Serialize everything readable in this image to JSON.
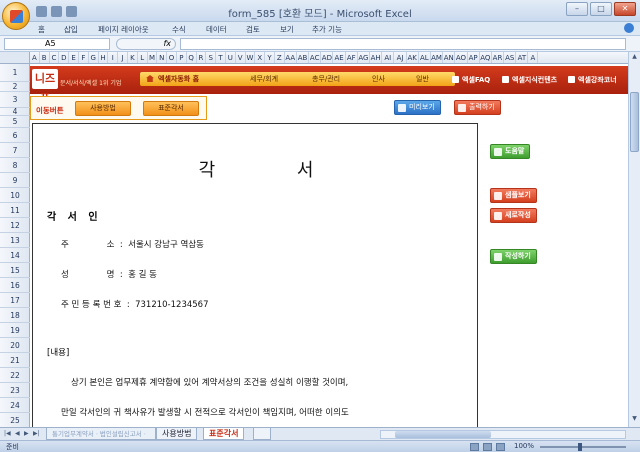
{
  "window": {
    "title": "form_585  [호환 모드] - Microsoft Excel"
  },
  "menu_tabs": [
    "홈",
    "삽입",
    "페이지 레이아웃",
    "수식",
    "데이터",
    "검토",
    "보기",
    "추가 기능"
  ],
  "formula_bar": {
    "cell_ref": "A5",
    "fx_label": "fx",
    "value": ""
  },
  "columns": [
    "A",
    "B",
    "C",
    "D",
    "E",
    "F",
    "G",
    "H",
    "I",
    "J",
    "K",
    "L",
    "M",
    "N",
    "O",
    "P",
    "Q",
    "R",
    "S",
    "T",
    "U",
    "V",
    "W",
    "X",
    "Y",
    "Z",
    "AA",
    "AB",
    "AC",
    "AD",
    "AE",
    "AF",
    "AG",
    "AH",
    "AI",
    "AJ",
    "AK",
    "AL",
    "AM",
    "AN",
    "AO",
    "AP",
    "AQ",
    "AR",
    "AS",
    "AT",
    "A"
  ],
  "rows": [
    "1",
    "2",
    "3",
    "4",
    "5",
    "6",
    "7",
    "8",
    "9",
    "10",
    "11",
    "12",
    "13",
    "14",
    "15",
    "16",
    "17",
    "18",
    "19",
    "20",
    "21",
    "22",
    "23",
    "24",
    "25"
  ],
  "banner": {
    "logo": "니즈폼",
    "logo_sub": "문서/서식/엑셀 1위 기업",
    "home": "엑셀자동화 홈",
    "nav": [
      "세무/회계",
      "총무/관리",
      "인사",
      "일반"
    ],
    "links": [
      "엑셀FAQ",
      "엑셀지식컨텐츠",
      "엑셀강좌코너"
    ]
  },
  "shortcuts": {
    "label": "이동버튼",
    "buttons": [
      "사용방법",
      "표준각서"
    ]
  },
  "actions": {
    "preview": "미리보기",
    "print": "출력하기"
  },
  "side_buttons": {
    "help": "도움말",
    "sample": "샘플보기",
    "new": "새로작성",
    "write": "작성하기"
  },
  "document": {
    "title": "각 서",
    "subtitle": "각 서 인",
    "fields": [
      {
        "label": "주              소",
        "value": "서울시 강남구 역삼동"
      },
      {
        "label": "성              명",
        "value": "홍 길 동"
      },
      {
        "label": "주 민 등 록 번 호",
        "value": "731210-1234567"
      }
    ],
    "section": "[내용]",
    "paragraphs": [
      "상기 본인은 업무제휴 계약함에 있어 계약서상의 조건을 성실히 이행할 것이며,",
      "만일 각서인의 귀 책사유가 발생할 시 전적으로 각서인이 책임지며, 어떠한 이의도"
    ]
  },
  "sheet_tabs": {
    "faded": "통기업무계약서ㆍ법인설립신고서ㆍ",
    "tabs": [
      "사용방법",
      "표준각서"
    ],
    "active": "표준각서"
  },
  "status": {
    "ready": "준비",
    "zoom": "100%"
  }
}
